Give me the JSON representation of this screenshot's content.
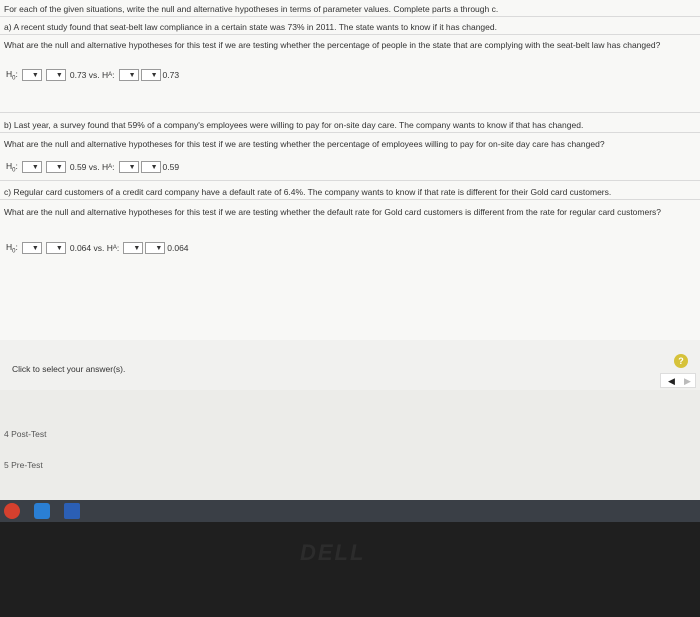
{
  "instructions": "For each of the given situations, write the null and alternative hypotheses in terms of parameter values. Complete parts a through c.",
  "part_a": {
    "statement": "a) A recent study found that seat-belt law compliance in a certain state was 73% in 2011. The state wants to know if it has changed.",
    "question": "What are the null and alternative hypotheses for this test if we are testing whether the percentage of people in the state that are complying with the seat-belt law has changed?",
    "h0_label": "H",
    "h0_sub": "0",
    "null_value": "0.73 vs. H",
    "alt_sub": "A",
    "alt_value": "0.73"
  },
  "part_b": {
    "statement": "b) Last year, a survey found that 59% of a company's employees were willing to pay for on-site day care. The company wants to know if that has changed.",
    "question": "What are the null and alternative hypotheses for this test if we are testing whether the percentage of employees willing to pay for on-site day care has changed?",
    "h0_label": "H",
    "h0_sub": "0",
    "null_value": "0.59 vs. H",
    "alt_sub": "A",
    "alt_value": "0.59"
  },
  "part_c": {
    "statement": "c) Regular card customers of a credit card company have a default rate of 6.4%. The company wants to know if that rate is different for their Gold card customers.",
    "question": "What are the null and alternative hypotheses for this test if we are testing whether the default rate for Gold card customers is different from the rate for regular card customers?",
    "h0_label": "H",
    "h0_sub": "0",
    "null_value": "0.064 vs. H",
    "alt_sub": "A",
    "alt_value": "0.064"
  },
  "dropdown_arrow": "▼",
  "click_to_select": "Click to select your answer(s).",
  "help_symbol": "?",
  "nav": {
    "prev": "◀",
    "next": "▶"
  },
  "side_links": [
    "4 Post-Test",
    "5 Pre-Test"
  ],
  "brand": "DELL"
}
